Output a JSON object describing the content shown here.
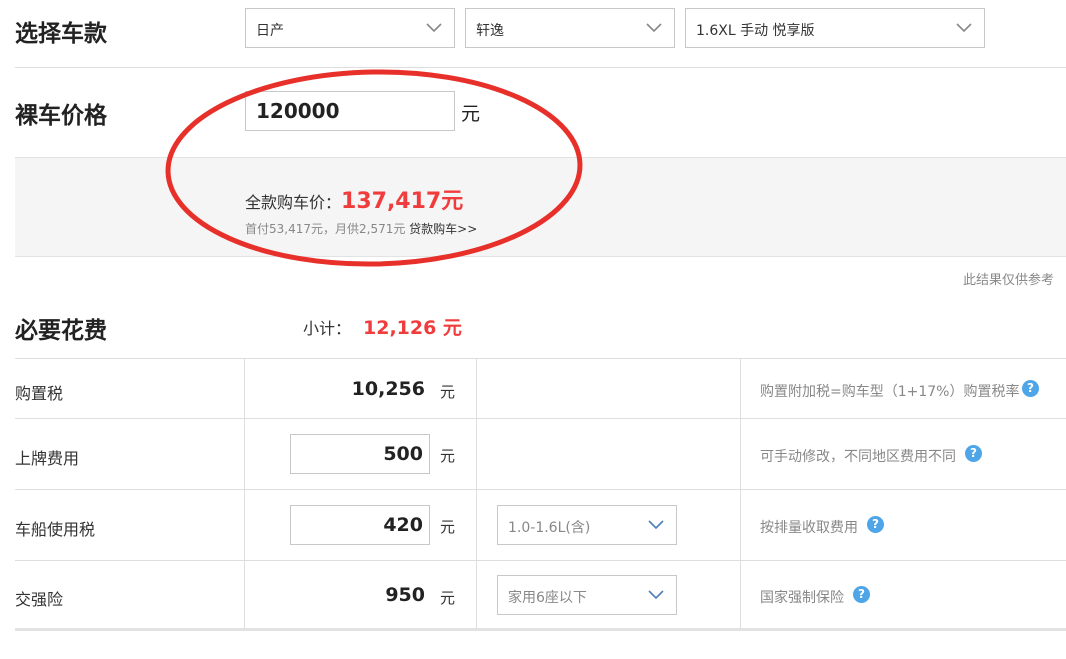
{
  "select_car": {
    "title": "选择车款",
    "brand": "日产",
    "series": "轩逸",
    "model": "1.6XL 手动 悦享版"
  },
  "bare_price": {
    "title": "裸车价格",
    "value": "120000",
    "unit": "元"
  },
  "result": {
    "full_label": "全款购车价：",
    "full_value": "137,417元",
    "sub_text": "首付53,417元，月供2,571元",
    "loan_link": "贷款购车>>",
    "disclaimer": "此结果仅供参考"
  },
  "required": {
    "title": "必要花费",
    "subtotal_label": "小计：",
    "subtotal_value": "12,126 元"
  },
  "rows": [
    {
      "label": "购置税",
      "value": "10,256",
      "unit": "元",
      "note": "购置附加税=购车型（1+17%）购置税率"
    },
    {
      "label": "上牌费用",
      "value": "500",
      "unit": "元",
      "note": "可手动修改，不同地区费用不同"
    },
    {
      "label": "车船使用税",
      "value": "420",
      "unit": "元",
      "option": "1.0-1.6L(含)",
      "note": "按排量收取费用"
    },
    {
      "label": "交强险",
      "value": "950",
      "unit": "元",
      "option": "家用6座以下",
      "note": "国家强制保险"
    }
  ],
  "colors": {
    "accent_red": "#f03c3c",
    "annotation_circle": "#e8302a",
    "help_icon": "#4ea5e8"
  },
  "icons": {
    "dropdown": "chevron-down-icon",
    "help": "question-mark-icon"
  }
}
